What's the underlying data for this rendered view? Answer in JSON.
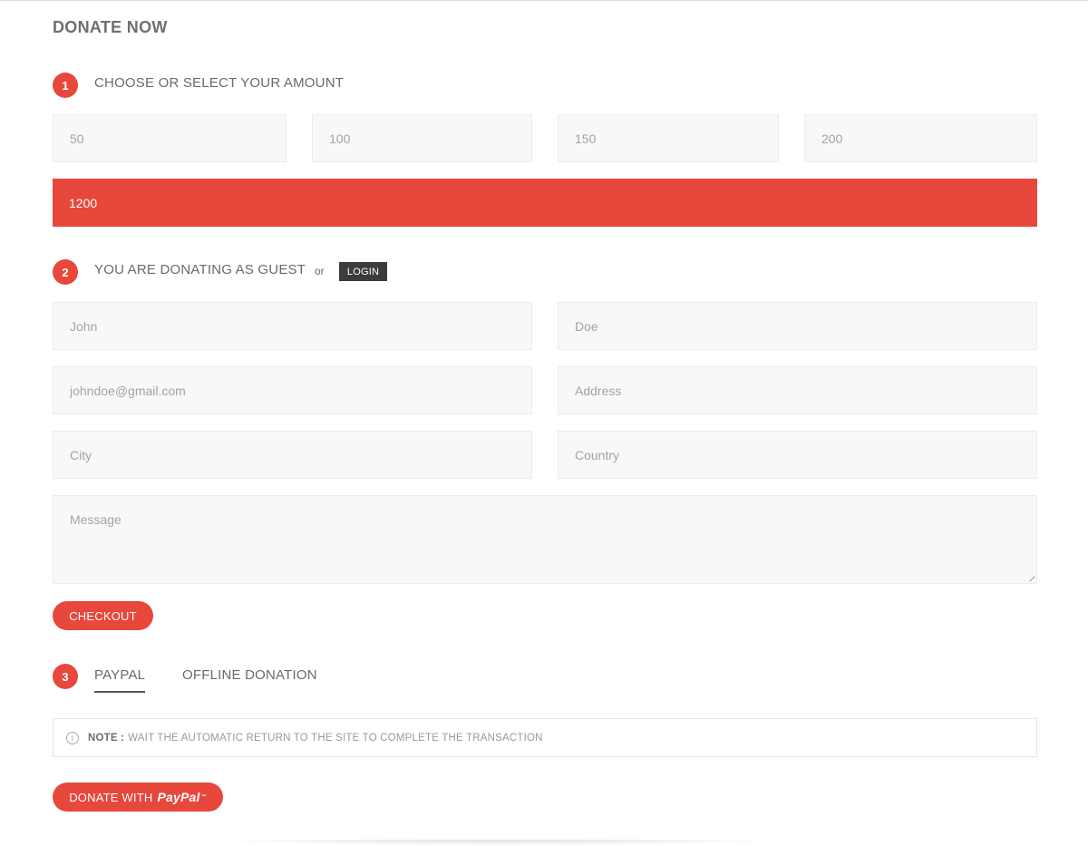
{
  "page": {
    "title": "DONATE NOW"
  },
  "step1": {
    "number": "1",
    "title": "CHOOSE OR SELECT YOUR AMOUNT",
    "amounts": [
      "50",
      "100",
      "150",
      "200"
    ],
    "selected_amount": "1200"
  },
  "step2": {
    "number": "2",
    "title": "YOU ARE DONATING AS GUEST",
    "or_text": "or",
    "login_label": "LOGIN",
    "fields": {
      "first_name": "John",
      "last_name": "Doe",
      "email": "johndoe@gmail.com",
      "address": "Address",
      "city": "City",
      "country": "Country",
      "message": "Message"
    },
    "checkout_label": "CHECKOUT"
  },
  "step3": {
    "number": "3",
    "tabs": [
      "PAYPAL",
      "OFFLINE DONATION"
    ],
    "active_tab": "PAYPAL",
    "note_label": "NOTE :",
    "note_text": "WAIT THE AUTOMATIC RETURN TO THE SITE TO COMPLETE THE TRANSACTION",
    "donate_label": "DONATE WITH",
    "paypal_logo": "PayPal",
    "paypal_tm": "™"
  },
  "colors": {
    "accent": "#e8473b",
    "field_bg": "#f8f8f8",
    "dark_button": "#3c3c3c"
  }
}
